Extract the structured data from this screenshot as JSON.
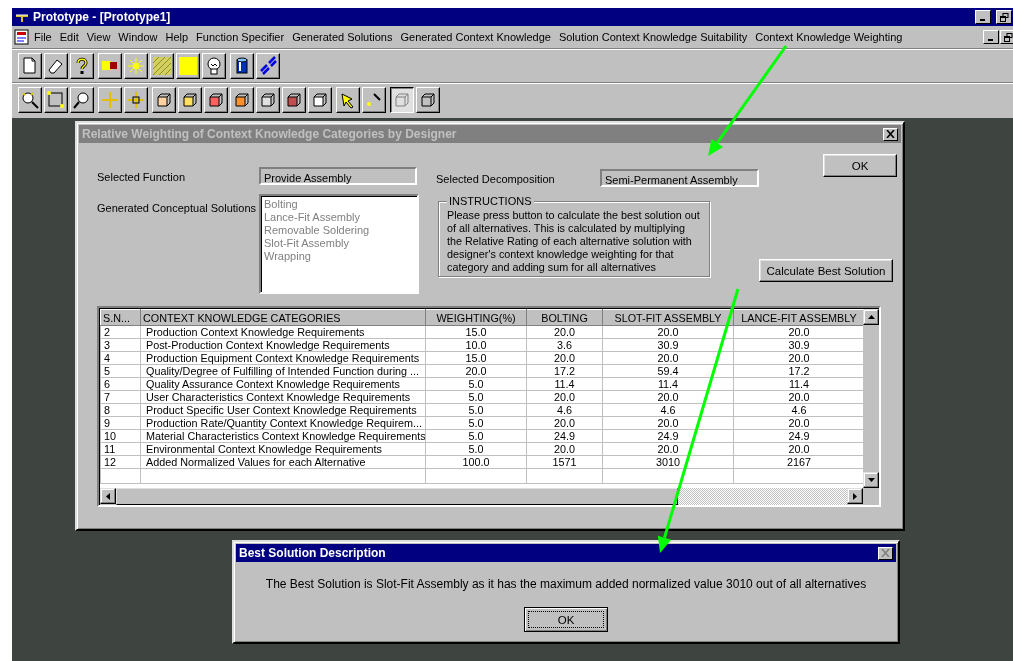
{
  "window": {
    "title": "Prototype - [Prototype1]"
  },
  "menu": [
    "File",
    "Edit",
    "View",
    "Window",
    "Help",
    "Function Specifier",
    "Generated Solutions",
    "Generated Context Knowledge",
    "Solution Context Knowledge Suitability",
    "Context Knowledge Weighting"
  ],
  "dialog": {
    "title": "Relative Weighting of Context Knowledge Categories by Designer",
    "active": false,
    "selected_function": {
      "label": "Selected Function",
      "value": "Provide Assembly"
    },
    "selected_decomposition": {
      "label": "Selected Decomposition",
      "value": "Semi-Permanent Assembly"
    },
    "ok_button": "OK",
    "solutions": {
      "label": "Generated Conceptual Solutions",
      "disabled": true,
      "items": [
        "Bolting",
        "Lance-Fit Assembly",
        "Removable Soldering",
        "Slot-Fit Assembly",
        "Wrapping"
      ]
    },
    "instructions": {
      "legend": "INSTRUCTIONS",
      "text": "Please press button to calculate the best solution out of all alternatives. This is calculated by multiplying the Relative Rating of each alternative solution with designer's context knowledge weighting for that category and adding sum for all alternatives"
    },
    "calculate_button": "Calculate Best Solution",
    "table": {
      "columns": [
        "S.N...",
        "CONTEXT KNOWLEDGE CATEGORIES",
        "WEIGHTING(%)",
        "BOLTING",
        "SLOT-FIT ASSEMBLY",
        "LANCE-FIT ASSEMBLY"
      ],
      "rows": [
        [
          "2",
          "Production Context Knowledge Requirements",
          "15.0",
          "20.0",
          "20.0",
          "20.0"
        ],
        [
          "3",
          "Post-Production Context Knowledge Requirements",
          "10.0",
          "3.6",
          "30.9",
          "30.9"
        ],
        [
          "4",
          "Production Equipment Context Knowledge Requirements",
          "15.0",
          "20.0",
          "20.0",
          "20.0"
        ],
        [
          "5",
          "Quality/Degree of Fulfilling of Intended Function during ...",
          "20.0",
          "17.2",
          "59.4",
          "17.2"
        ],
        [
          "6",
          "Quality Assurance Context Knowledge Requirements",
          "5.0",
          "11.4",
          "11.4",
          "11.4"
        ],
        [
          "7",
          "User Characteristics Context Knowledge Requirements",
          "5.0",
          "20.0",
          "20.0",
          "20.0"
        ],
        [
          "8",
          "Product Specific User Context Knowledge Requirements",
          "5.0",
          "4.6",
          "4.6",
          "4.6"
        ],
        [
          "9",
          "Production Rate/Quantity Context Knowledge Requirem...",
          "5.0",
          "20.0",
          "20.0",
          "20.0"
        ],
        [
          "10",
          "Material Characteristics Context Knowledge Requirements",
          "5.0",
          "24.9",
          "24.9",
          "24.9"
        ],
        [
          "11",
          "Environmental Context Knowledge Requirements",
          "5.0",
          "20.0",
          "20.0",
          "20.0"
        ],
        [
          "12",
          "Added Normalized Values for each Alternative",
          "100.0",
          "1571",
          "3010",
          "2167"
        ]
      ]
    }
  },
  "best_dialog": {
    "title": "Best Solution Description",
    "active": true,
    "message": "The Best Solution is Slot-Fit Assembly as it has the maximum added normalized value 3010 out of all alternatives",
    "ok_button": "OK"
  }
}
